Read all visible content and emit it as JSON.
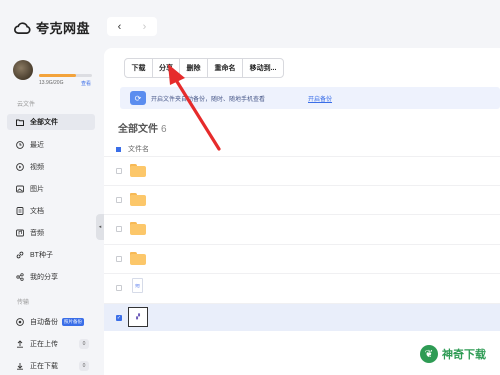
{
  "app": {
    "name": "夸克网盘"
  },
  "nav": {
    "back": "‹",
    "forward": "›"
  },
  "user": {
    "storage_text": "13.9G/20G",
    "storage_link": "查看",
    "storage_used_fraction": 0.695
  },
  "sidebar": {
    "section_cloud": "云文件",
    "items": [
      {
        "label": "全部文件",
        "icon": "folder-icon"
      },
      {
        "label": "最近",
        "icon": "clock-icon"
      },
      {
        "label": "视频",
        "icon": "video-icon"
      },
      {
        "label": "图片",
        "icon": "image-icon"
      },
      {
        "label": "文档",
        "icon": "document-icon"
      },
      {
        "label": "音频",
        "icon": "audio-icon"
      },
      {
        "label": "BT种子",
        "icon": "link-icon"
      },
      {
        "label": "我的分享",
        "icon": "share-icon"
      }
    ],
    "section_transfer": "传输",
    "transfer": [
      {
        "label": "自动备份",
        "badge": "照片备份",
        "icon": "backup-icon"
      },
      {
        "label": "正在上传",
        "count": "0",
        "icon": "upload-icon"
      },
      {
        "label": "正在下载",
        "count": "0",
        "icon": "download-icon"
      }
    ]
  },
  "toolbar": {
    "download": "下载",
    "share": "分享",
    "delete": "删除",
    "rename": "重命名",
    "move": "移动到..."
  },
  "banner": {
    "text": "开启文件夹自动备份，随时、随地手机查看",
    "link": "开启备份"
  },
  "files": {
    "title": "全部文件",
    "count": "6",
    "column_name": "文件名",
    "rows": [
      {
        "type": "folder"
      },
      {
        "type": "folder"
      },
      {
        "type": "folder"
      },
      {
        "type": "folder"
      },
      {
        "type": "document"
      },
      {
        "type": "image",
        "selected": true
      }
    ]
  },
  "watermark": {
    "text": "神奇下载"
  },
  "colors": {
    "accent": "#3a6ee8",
    "folder": "#fcc76a",
    "arrow": "#e62b2b"
  }
}
